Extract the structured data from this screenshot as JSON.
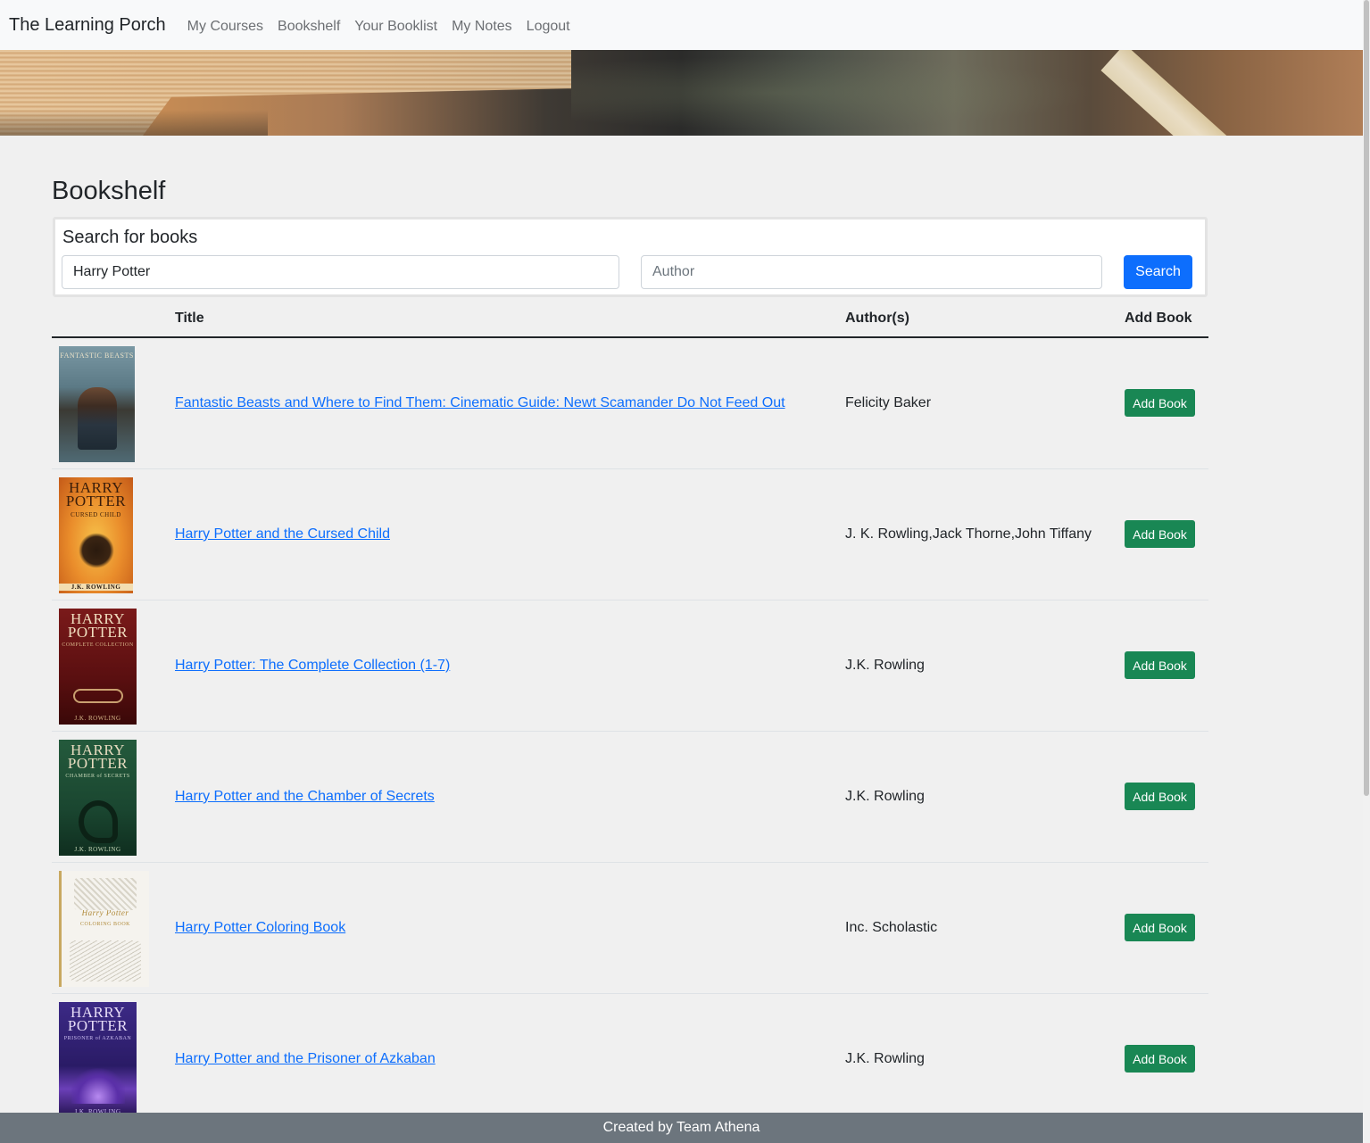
{
  "nav": {
    "brand": "The Learning Porch",
    "links": [
      "My Courses",
      "Bookshelf",
      "Your Booklist",
      "My Notes",
      "Logout"
    ]
  },
  "page": {
    "title": "Bookshelf"
  },
  "search": {
    "heading": "Search for books",
    "title_value": "Harry Potter",
    "author_placeholder": "Author",
    "button_label": "Search"
  },
  "table": {
    "headers": {
      "title": "Title",
      "author": "Author(s)",
      "add": "Add Book"
    },
    "rows": [
      {
        "title": "Fantastic Beasts and Where to Find Them: Cinematic Guide: Newt Scamander Do Not Feed Out",
        "author": "Felicity Baker",
        "button": "Add Book",
        "cover": {
          "top_text": "FANTASTIC BEASTS",
          "sub_text": "",
          "author_text": "",
          "bg": "#5f7e8a"
        }
      },
      {
        "title": "Harry Potter and the Cursed Child",
        "author": "J. K. Rowling,Jack Thorne,John Tiffany",
        "button": "Add Book",
        "cover": {
          "top_text": "HARRY POTTER",
          "sub_text": "CURSED CHILD",
          "author_text": "J.K. ROWLING",
          "bg": "#e8892c"
        }
      },
      {
        "title": "Harry Potter: The Complete Collection (1-7)",
        "author": "J.K. Rowling",
        "button": "Add Book",
        "cover": {
          "top_text": "HARRY POTTER",
          "sub_text": "COMPLETE COLLECTION",
          "author_text": "J.K. ROWLING",
          "bg": "#6b1414"
        }
      },
      {
        "title": "Harry Potter and the Chamber of Secrets",
        "author": "J.K. Rowling",
        "button": "Add Book",
        "cover": {
          "top_text": "HARRY POTTER",
          "sub_text": "CHAMBER of SECRETS",
          "author_text": "J.K. ROWLING",
          "bg": "#1f4d35"
        }
      },
      {
        "title": "Harry Potter Coloring Book",
        "author": "Inc. Scholastic",
        "button": "Add Book",
        "cover": {
          "top_text": "Harry Potter",
          "sub_text": "COLORING BOOK",
          "author_text": "",
          "bg": "#f4f2ec"
        }
      },
      {
        "title": "Harry Potter and the Prisoner of Azkaban",
        "author": "J.K. Rowling",
        "button": "Add Book",
        "cover": {
          "top_text": "HARRY POTTER",
          "sub_text": "PRISONER of AZKABAN",
          "author_text": "J.K. ROWLING",
          "bg": "#3a1f7a"
        }
      }
    ]
  },
  "footer": {
    "text": "Created by Team Athena"
  },
  "colors": {
    "primary": "#0d6efd",
    "success": "#198754",
    "footer_bg": "#6c757d",
    "page_bg": "#f0f0f0"
  }
}
